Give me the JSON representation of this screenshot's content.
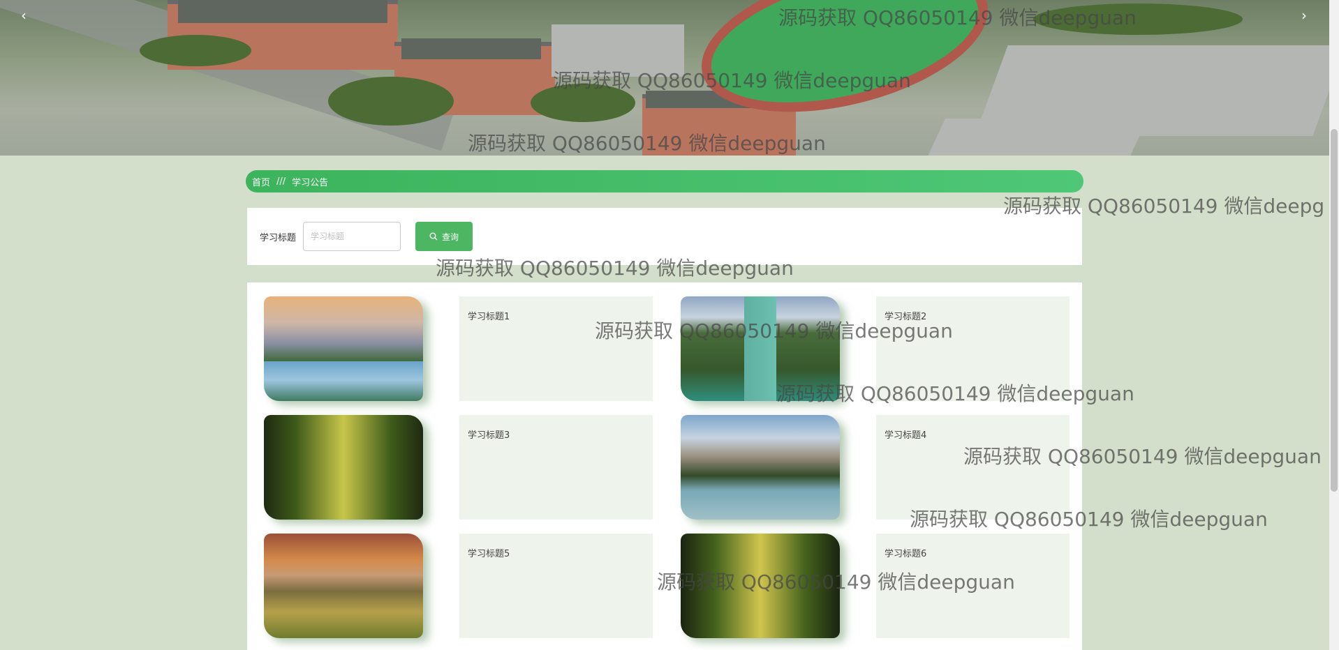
{
  "banner": {
    "prev_arrow": "‹",
    "next_arrow": "›"
  },
  "breadcrumb": {
    "home": "首页",
    "separator": "///",
    "current": "学习公告"
  },
  "search": {
    "label": "学习标题",
    "placeholder": "学习标题",
    "button_label": "查询",
    "button_icon": "search-icon"
  },
  "items": [
    {
      "title": "学习标题1"
    },
    {
      "title": "学习标题2"
    },
    {
      "title": "学习标题3"
    },
    {
      "title": "学习标题4"
    },
    {
      "title": "学习标题5"
    },
    {
      "title": "学习标题6"
    }
  ],
  "watermark_text": "源码获取 QQ86050149 微信deepguan",
  "watermark_text_cut": "源码获取 QQ86050149 微信deepg",
  "colors": {
    "accent": "#4cb663",
    "page_bg": "#d3dfca",
    "card_info_bg": "#eef4ec"
  }
}
